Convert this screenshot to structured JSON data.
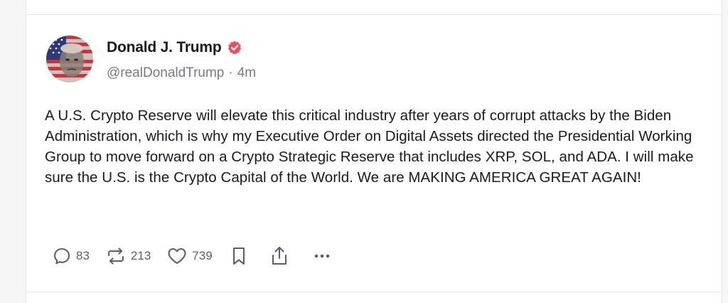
{
  "post": {
    "author": {
      "display_name": "Donald J. Trump",
      "handle": "@realDonaldTrump",
      "separator": "·",
      "timestamp": "4m",
      "verified_badge_color": "#e8505b"
    },
    "body": "A U.S. Crypto Reserve will elevate this critical industry after years of corrupt attacks by the Biden Administration, which is why my Executive Order on Digital Assets directed the Presidential Working Group to move forward on a Crypto Strategic Reserve that includes XRP, SOL, and ADA. I will make sure the U.S. is the Crypto Capital of the World. We are MAKING AMERICA GREAT AGAIN!",
    "actions": {
      "replies": "83",
      "reposts": "213",
      "likes": "739"
    },
    "icons": [
      "reply-icon",
      "repost-icon",
      "heart-icon",
      "bookmark-icon",
      "share-icon",
      "more-icon"
    ]
  }
}
